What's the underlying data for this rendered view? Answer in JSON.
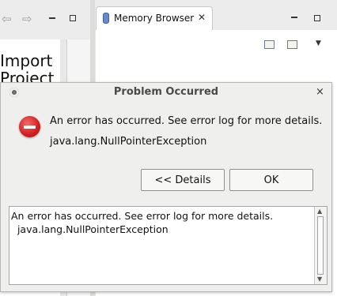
{
  "workbench": {
    "left_view": {
      "toolbar": {
        "back_icon": "arrow-left-icon",
        "forward_icon": "arrow-right-icon",
        "minimize_icon": "minimize-icon",
        "maximize_icon": "maximize-icon"
      },
      "content_text": "Import\nProject"
    },
    "memory_browser": {
      "tab_label": "Memory Browser",
      "tab_icon": "memory-chip-icon",
      "close_glyph": "✕",
      "toolbar": {
        "new_tab_icon": "new-tab-icon",
        "edit_icon": "edit-icon",
        "view_menu_glyph": "▼",
        "minimize_icon": "minimize-icon",
        "maximize_icon": "maximize-icon"
      }
    }
  },
  "dialog": {
    "title": "Problem Occurred",
    "close_glyph": "×",
    "icon": "error-icon",
    "message": "An error has occurred. See error log for more details.",
    "exception": "java.lang.NullPointerException",
    "buttons": {
      "details_label": "<< Details",
      "ok_label": "OK"
    },
    "details_text": "An error has occurred. See error log for more details.\n  java.lang.NullPointerException",
    "colors": {
      "error_red": "#d31e1e",
      "title_gray": "#4a4a4a"
    }
  }
}
